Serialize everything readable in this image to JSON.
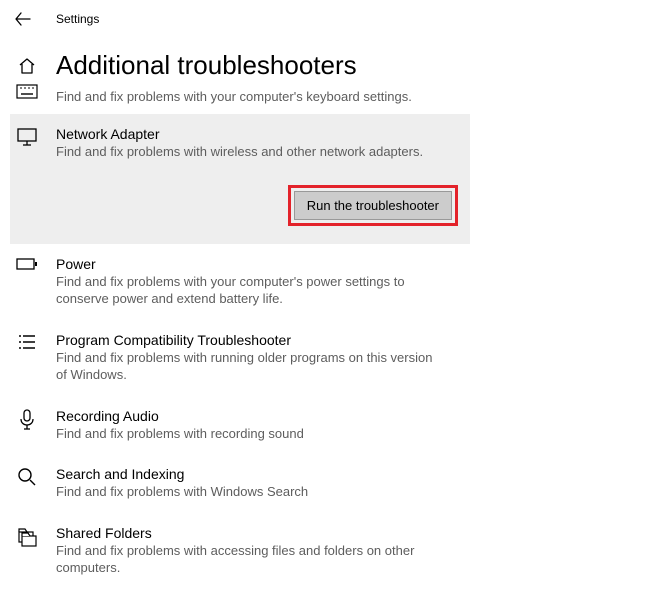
{
  "app_name": "Settings",
  "page_title": "Additional troubleshooters",
  "keyboard_desc": "Find and fix problems with your computer's keyboard settings.",
  "items": {
    "network": {
      "title": "Network Adapter",
      "desc": "Find and fix problems with wireless and other network adapters.",
      "run_label": "Run the troubleshooter"
    },
    "power": {
      "title": "Power",
      "desc": "Find and fix problems with your computer's power settings to conserve power and extend battery life."
    },
    "compat": {
      "title": "Program Compatibility Troubleshooter",
      "desc": "Find and fix problems with running older programs on this version of Windows."
    },
    "recording": {
      "title": "Recording Audio",
      "desc": "Find and fix problems with recording sound"
    },
    "search": {
      "title": "Search and Indexing",
      "desc": "Find and fix problems with Windows Search"
    },
    "shared": {
      "title": "Shared Folders",
      "desc": "Find and fix problems with accessing files and folders on other computers."
    }
  }
}
